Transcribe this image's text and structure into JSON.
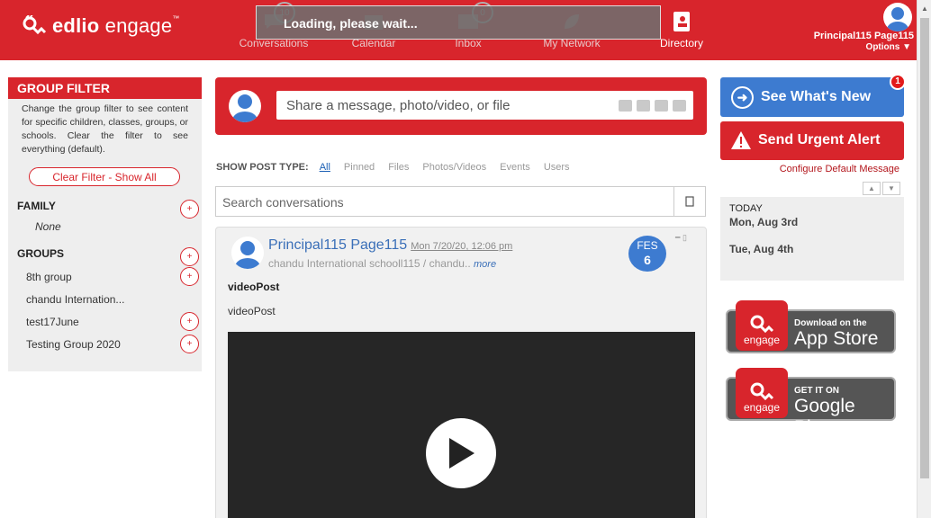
{
  "header": {
    "brand_bold": "edlio",
    "brand_light": "engage",
    "brand_sup": "™",
    "nav": [
      {
        "label": "Conversations",
        "badge": "10"
      },
      {
        "label": "Calendar"
      },
      {
        "label": "Inbox",
        "badge": "0"
      },
      {
        "label": "My Network"
      },
      {
        "label": "Directory"
      }
    ],
    "loading": "Loading, please wait...",
    "user_name": "Principal115 Page115",
    "options": "Options ▼"
  },
  "group_filter": {
    "title": "GROUP FILTER",
    "description": "Change the group filter to see content for specific children, classes, groups, or schools. Clear the filter to see everything (default).",
    "clear_button": "Clear Filter - Show All",
    "family_title": "FAMILY",
    "family_none": "None",
    "groups_title": "GROUPS",
    "groups": [
      "8th group",
      "chandu Internation...",
      "test17June",
      "Testing Group 2020"
    ],
    "plus": "+"
  },
  "composer": {
    "placeholder": "Share a message, photo/video, or file"
  },
  "post_types": {
    "label": "SHOW POST TYPE:",
    "types": [
      "All",
      "Pinned",
      "Files",
      "Photos/Videos",
      "Events",
      "Users"
    ]
  },
  "search": {
    "placeholder": "Search conversations"
  },
  "post": {
    "author": "Principal115 Page115",
    "date": "Mon 7/20/20, 12:06 pm",
    "school": "chandu International schooll115",
    "separator": "/",
    "group": "chandu..",
    "more": "more",
    "badge_month": "FES",
    "badge_day": "6",
    "title": "videoPost",
    "body": "videoPost"
  },
  "right": {
    "see_new": "See What's New",
    "notif_count": "1",
    "urgent": "Send Urgent Alert",
    "configure": "Configure Default Message",
    "today_label": "TODAY",
    "day1": "Mon, Aug 3rd",
    "day2": "Tue, Aug 4th",
    "appstore_small": "Download on the",
    "appstore_big": "App Store",
    "gplay_small": "GET IT ON",
    "gplay_big": "Google Play",
    "app_label": "engage"
  },
  "colors": {
    "brand_red": "#d8252c",
    "accent_blue": "#3d7bd0"
  }
}
